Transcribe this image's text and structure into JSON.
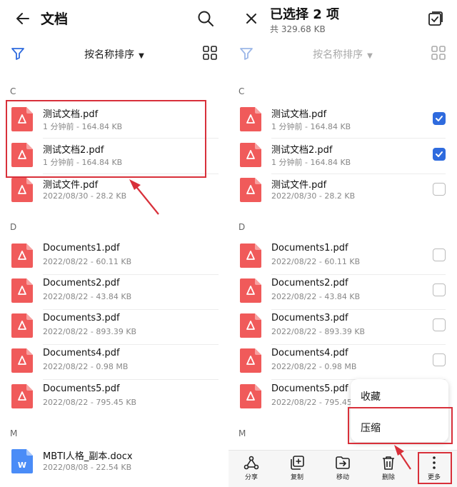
{
  "left_panel": {
    "title": "文档",
    "sort_label": "按名称排序",
    "sections": [
      "C",
      "D",
      "M"
    ],
    "files_c": [
      {
        "name": "测试文档.pdf",
        "meta": "1 分钟前 - 164.84 KB"
      },
      {
        "name": "测试文档2.pdf",
        "meta": "1 分钟前 - 164.84 KB"
      },
      {
        "name": "测试文件.pdf",
        "meta": "2022/08/30 - 28.2 KB"
      }
    ],
    "files_d": [
      {
        "name": "Documents1.pdf",
        "meta": "2022/08/22 - 60.11 KB"
      },
      {
        "name": "Documents2.pdf",
        "meta": "2022/08/22 - 43.84 KB"
      },
      {
        "name": "Documents3.pdf",
        "meta": "2022/08/22 - 893.39 KB"
      },
      {
        "name": "Documents4.pdf",
        "meta": "2022/08/22 - 0.98 MB"
      },
      {
        "name": "Documents5.pdf",
        "meta": "2022/08/22 - 795.45 KB"
      }
    ],
    "files_m": [
      {
        "name": "MBTI人格_副本.docx",
        "meta": "2022/08/08 - 22.54 KB"
      }
    ]
  },
  "right_panel": {
    "title": "已选择 2 项",
    "subtitle": "共 329.68 KB",
    "sort_label": "按名称排序",
    "checked": [
      true,
      true,
      false,
      false,
      false,
      false,
      false,
      false
    ]
  },
  "popup_menu": {
    "items": [
      "收藏",
      "压缩"
    ]
  },
  "toolbar": {
    "share": "分享",
    "copy": "复制",
    "move": "移动",
    "delete": "删除",
    "more": "更多"
  },
  "colors": {
    "pdf_red": "#f05a5a",
    "doc_blue": "#4a8cf7",
    "accent": "#2f6bde",
    "highlight_red": "#d8303a"
  },
  "icons": [
    "back-arrow-icon",
    "search-icon",
    "close-icon",
    "select-all-icon",
    "filter-icon",
    "grid-view-icon",
    "pdf-file-icon",
    "word-file-icon",
    "share-icon",
    "copy-icon",
    "move-icon",
    "delete-icon",
    "more-icon"
  ]
}
